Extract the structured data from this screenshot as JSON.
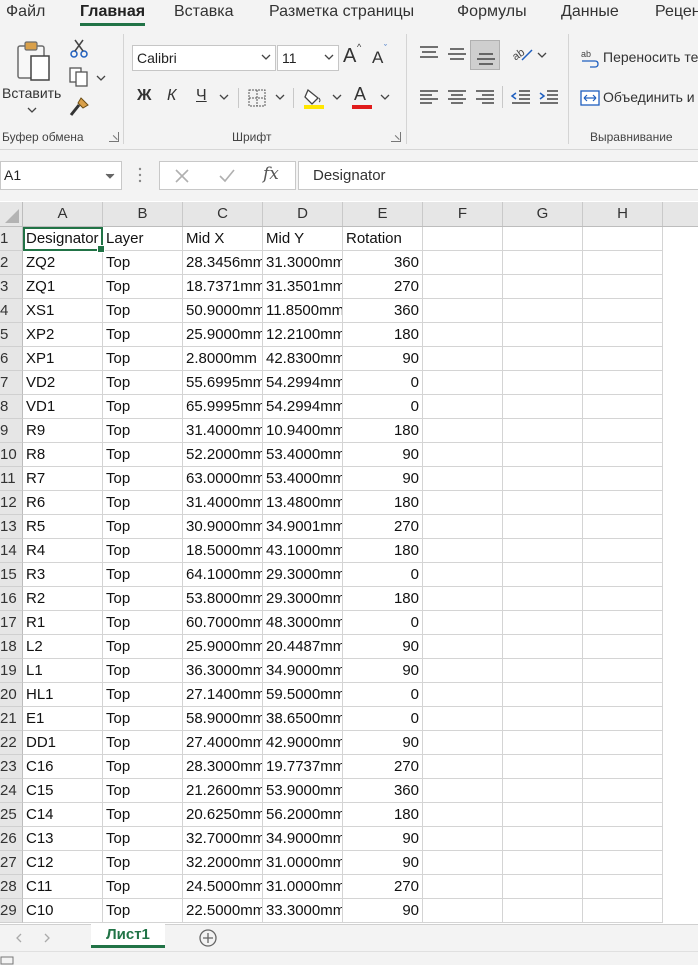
{
  "menu": {
    "tabs": [
      "Файл",
      "Главная",
      "Вставка",
      "Разметка страницы",
      "Формулы",
      "Данные",
      "Реценз"
    ],
    "active": "Главная"
  },
  "ribbon": {
    "clipboard": {
      "paste_label": "Вставить",
      "group_label": "Буфер обмена"
    },
    "font": {
      "font_name": "Calibri",
      "font_size": "11",
      "bold_label": "Ж",
      "italic_label": "К",
      "underline_label": "Ч",
      "grow_label": "A",
      "shrink_label": "A",
      "font_color_label": "A",
      "group_label": "Шрифт",
      "font_color": "#e01b1b",
      "highlight_color": "#ffe600"
    },
    "alignment": {
      "wrap_text_label": "Переносить те",
      "merge_label": "Объединить и",
      "group_label": "Выравнивание"
    }
  },
  "formula_bar": {
    "name_box": "A1",
    "fx_label": "fx",
    "content": "Designator"
  },
  "grid": {
    "columns": [
      "A",
      "B",
      "C",
      "D",
      "E",
      "F",
      "G",
      "H"
    ],
    "rows": [
      [
        "Designator",
        "Layer",
        "Mid X",
        "Mid Y",
        "Rotation"
      ],
      [
        "ZQ2",
        "Top",
        "28.3456mm",
        "31.3000mm",
        "360"
      ],
      [
        "ZQ1",
        "Top",
        "18.7371mm",
        "31.3501mm",
        "270"
      ],
      [
        "XS1",
        "Top",
        "50.9000mm",
        "11.8500mm",
        "360"
      ],
      [
        "XP2",
        "Top",
        "25.9000mm",
        "12.2100mm",
        "180"
      ],
      [
        "XP1",
        "Top",
        "2.8000mm",
        "42.8300mm",
        "90"
      ],
      [
        "VD2",
        "Top",
        "55.6995mm",
        "54.2994mm",
        "0"
      ],
      [
        "VD1",
        "Top",
        "65.9995mm",
        "54.2994mm",
        "0"
      ],
      [
        "R9",
        "Top",
        "31.4000mm",
        "10.9400mm",
        "180"
      ],
      [
        "R8",
        "Top",
        "52.2000mm",
        "53.4000mm",
        "90"
      ],
      [
        "R7",
        "Top",
        "63.0000mm",
        "53.4000mm",
        "90"
      ],
      [
        "R6",
        "Top",
        "31.4000mm",
        "13.4800mm",
        "180"
      ],
      [
        "R5",
        "Top",
        "30.9000mm",
        "34.9001mm",
        "270"
      ],
      [
        "R4",
        "Top",
        "18.5000mm",
        "43.1000mm",
        "180"
      ],
      [
        "R3",
        "Top",
        "64.1000mm",
        "29.3000mm",
        "0"
      ],
      [
        "R2",
        "Top",
        "53.8000mm",
        "29.3000mm",
        "180"
      ],
      [
        "R1",
        "Top",
        "60.7000mm",
        "48.3000mm",
        "0"
      ],
      [
        "L2",
        "Top",
        "25.9000mm",
        "20.4487mm",
        "90"
      ],
      [
        "L1",
        "Top",
        "36.3000mm",
        "34.9000mm",
        "90"
      ],
      [
        "HL1",
        "Top",
        "27.1400mm",
        "59.5000mm",
        "0"
      ],
      [
        "E1",
        "Top",
        "58.9000mm",
        "38.6500mm",
        "0"
      ],
      [
        "DD1",
        "Top",
        "27.4000mm",
        "42.9000mm",
        "90"
      ],
      [
        "C16",
        "Top",
        "28.3000mm",
        "19.7737mm",
        "270"
      ],
      [
        "C15",
        "Top",
        "21.2600mm",
        "53.9000mm",
        "360"
      ],
      [
        "C14",
        "Top",
        "20.6250mm",
        "56.2000mm",
        "180"
      ],
      [
        "C13",
        "Top",
        "32.7000mm",
        "34.9000mm",
        "90"
      ],
      [
        "C12",
        "Top",
        "32.2000mm",
        "31.0000mm",
        "90"
      ],
      [
        "C11",
        "Top",
        "24.5000mm",
        "31.0000mm",
        "270"
      ],
      [
        "C10",
        "Top",
        "22.5000mm",
        "33.3000mm",
        "90"
      ]
    ]
  },
  "sheets": {
    "active": "Лист1"
  },
  "accent_color": "#217346"
}
